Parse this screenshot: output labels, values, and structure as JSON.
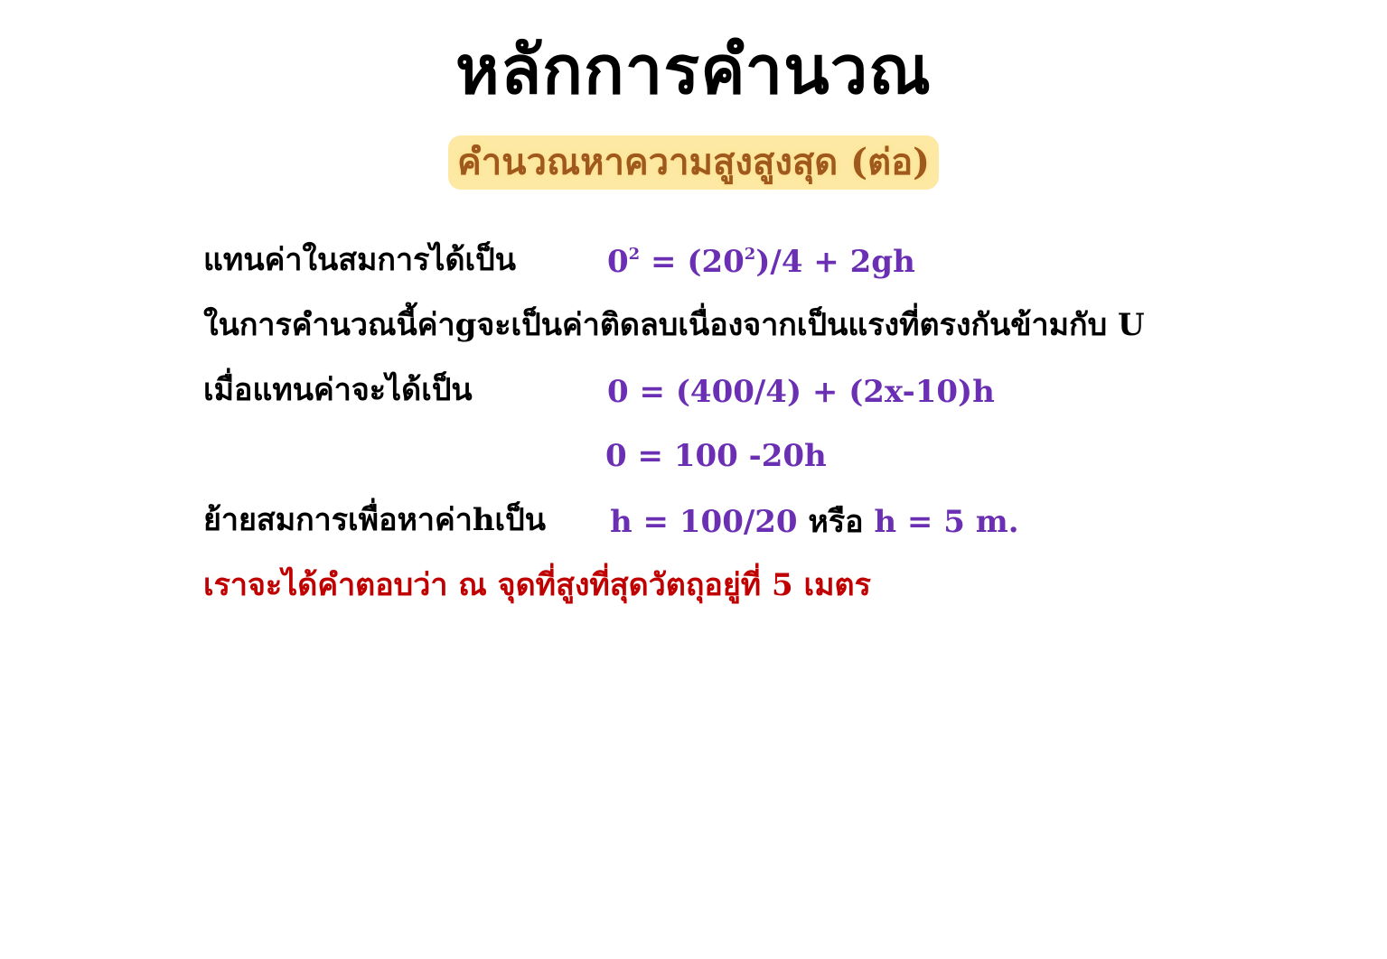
{
  "title": "หลักการคำนวณ",
  "subtitle": "คำนวณหาความสูงสูงสุด (ต่อ)",
  "lines": {
    "l1": {
      "label": "แทนค่าในสมการได้เป็น",
      "eq_a": "0",
      "eq_a_exp": "2",
      "eq_b": " = (20",
      "eq_b_exp": "2",
      "eq_c": ")/4 + 2gh"
    },
    "l2": {
      "text": "ในการคำนวณนี้ค่าgจะเป็นค่าติดลบเนื่องจากเป็นแรงที่ตรงกันข้ามกับ U"
    },
    "l3": {
      "label": "เมื่อแทนค่าจะได้เป็น",
      "eq": "0 = (400/4) + (2x-10)h"
    },
    "l4": {
      "eq": "0 = 100 -20h"
    },
    "l5": {
      "label": "ย้ายสมการเพื่อหาค่าhเป็น",
      "eq_a": "h = 100/20",
      "word": " หรือ ",
      "eq_b": "h = 5 m."
    },
    "l6": {
      "text": "เราจะได้คำตอบว่า ณ จุดที่สูงที่สุดวัตถุอยู่ที่ 5 เมตร"
    }
  },
  "colors": {
    "equation": "#6b2fb3",
    "answer": "#c00000",
    "subtitle_text": "#a0591c",
    "subtitle_highlight": "#fde9a3"
  }
}
